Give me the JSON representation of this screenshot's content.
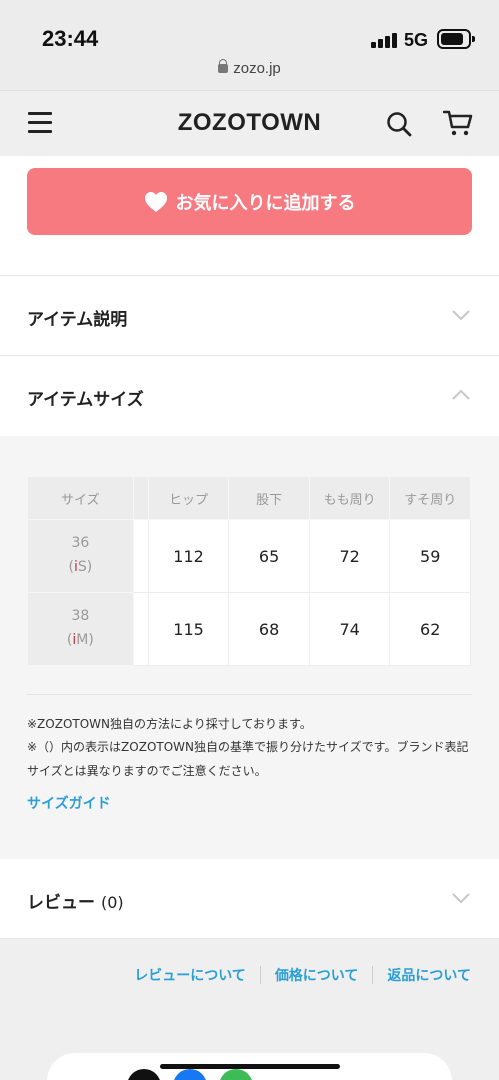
{
  "status_bar": {
    "time": "23:44",
    "network": "5G",
    "url": "zozo.jp"
  },
  "header": {
    "logo": "ZOZOTOWN"
  },
  "favorite_button": {
    "label": "お気に入りに追加する"
  },
  "accordions": {
    "item_description": {
      "title": "アイテム説明"
    },
    "item_size": {
      "title": "アイテムサイズ"
    },
    "review": {
      "title": "レビュー",
      "count": "(0)"
    }
  },
  "size_table": {
    "headers": [
      "サイズ",
      "ヒップ",
      "股下",
      "もも周り",
      "すそ周り"
    ],
    "rows": [
      {
        "size": "36",
        "mark_prefix": "(",
        "mark_icon": "i",
        "mark_letter": "S",
        "mark_suffix": ")",
        "values": [
          "112",
          "65",
          "72",
          "59"
        ]
      },
      {
        "size": "38",
        "mark_prefix": "(",
        "mark_icon": "i",
        "mark_letter": "M",
        "mark_suffix": ")",
        "values": [
          "115",
          "68",
          "74",
          "62"
        ]
      }
    ]
  },
  "notes": {
    "line1": "※ZOZOTOWN独自の方法により採寸しております。",
    "line2": "※（）内の表示はZOZOTOWN独自の基準で振り分けたサイズです。ブランド表記サイズとは異なりますのでご注意ください。",
    "size_guide": "サイズガイド"
  },
  "footer_links": [
    "レビューについて",
    "価格について",
    "返品について"
  ],
  "colors": {
    "favorite": "#f77a80",
    "link": "#2a9fd6",
    "size_mark": "#d0323a"
  }
}
